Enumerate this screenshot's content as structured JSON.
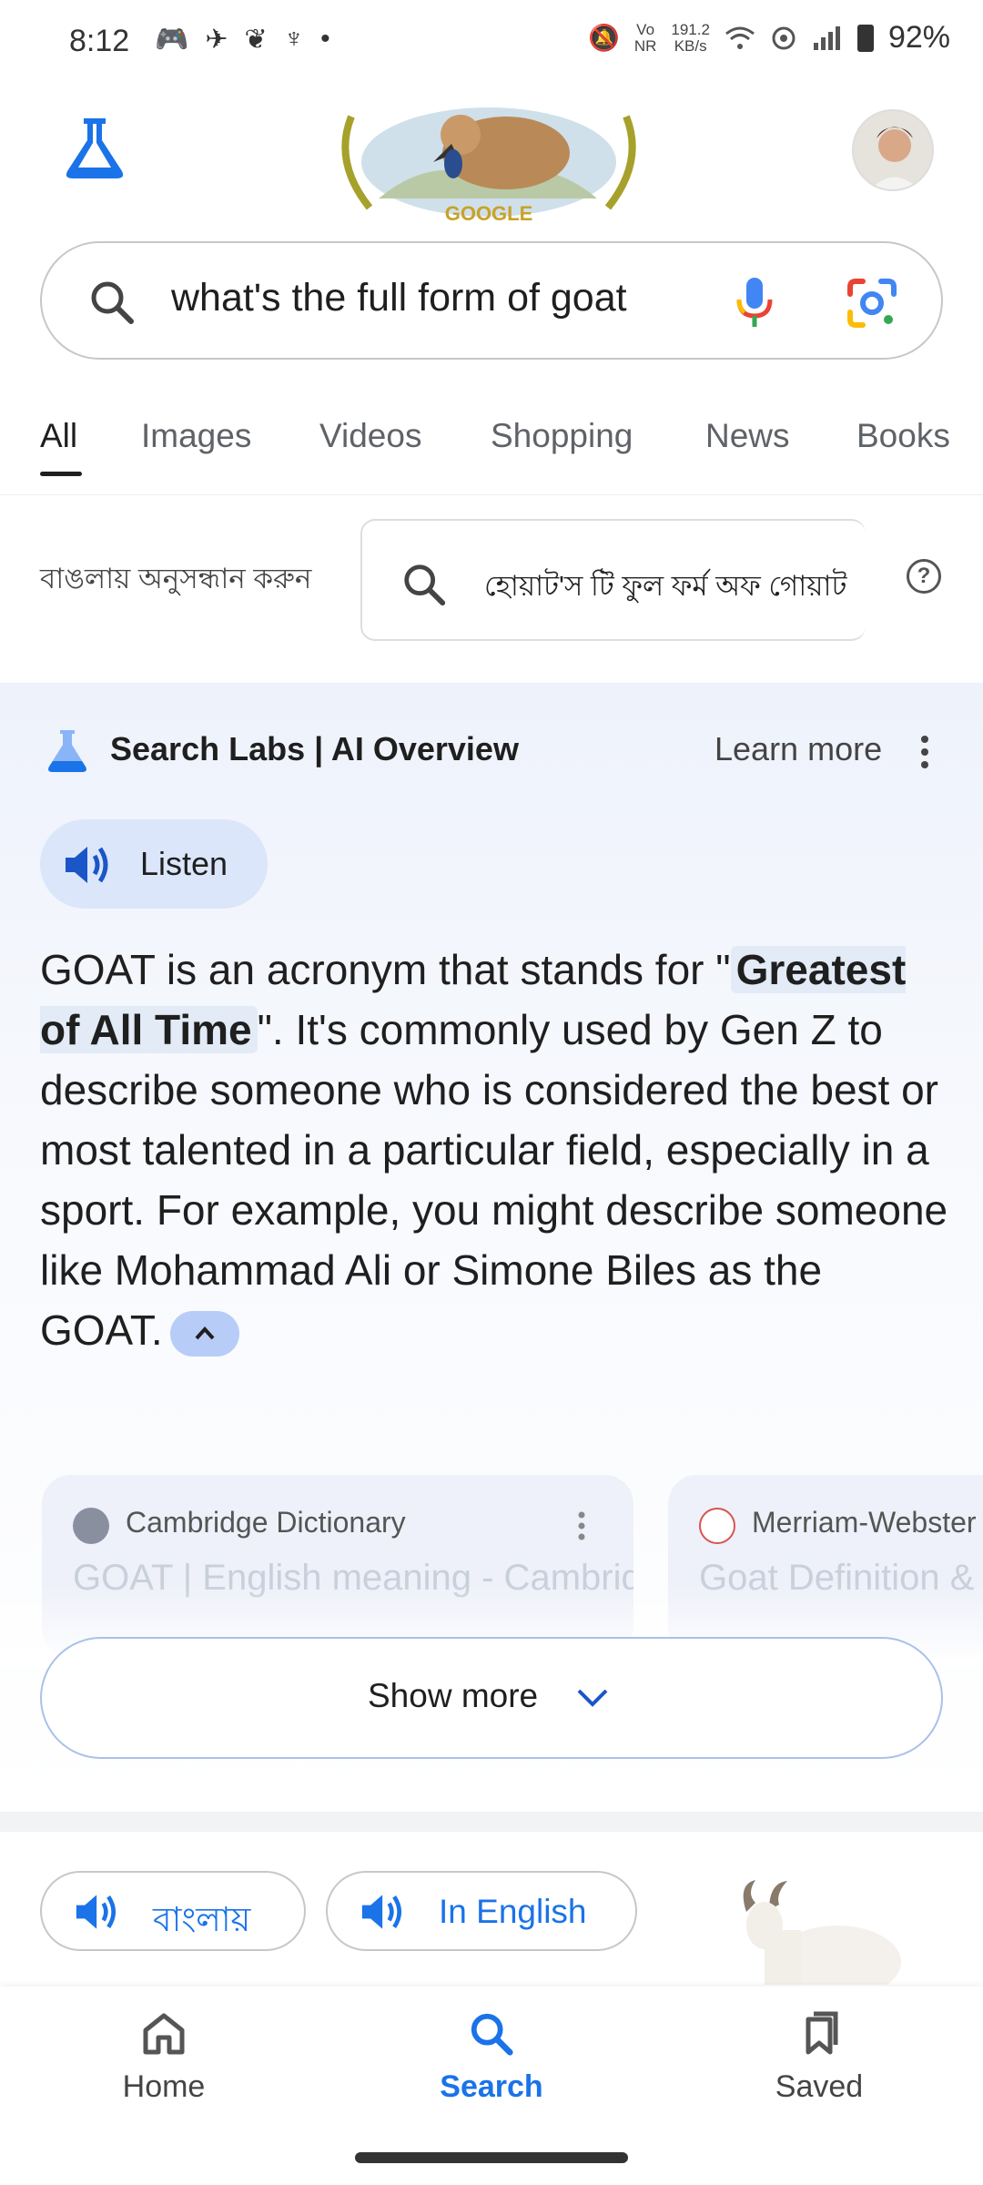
{
  "status_bar": {
    "time": "8:12",
    "net_speed_top": "191.2",
    "net_speed_unit": "KB/s",
    "vo_label": "Vo",
    "nr_label": "NR",
    "battery": "92%"
  },
  "header": {
    "doodle_text": "GOOGLE"
  },
  "search": {
    "query": "what's the full form of goat"
  },
  "tabs": [
    "All",
    "Images",
    "Videos",
    "Shopping",
    "News",
    "Books"
  ],
  "bengali": {
    "label": "বাঙলায় অনুসন্ধান করুন",
    "query": "হোয়াট'স টি ফুল ফর্ম অফ গোয়াট"
  },
  "ai_overview": {
    "title": "Search Labs | AI Overview",
    "learn_more": "Learn more",
    "listen_label": "Listen",
    "text_before": "GOAT is an acronym that stands for \"",
    "highlight": "Greatest of All Time",
    "text_after": "\". It's commonly used by Gen Z to describe someone who is considered the best or most talented in a particular field, especially in a sport. For example, you might describe someone like Mohammad Ali or Simone Biles as the GOAT.",
    "sources": [
      {
        "name": "Cambridge Dictionary",
        "title": "GOAT | English meaning - Cambridge Dictionary"
      },
      {
        "name": "Merriam-Webster",
        "title": "Goat Definition & Meaning - Merriam-Webster"
      }
    ],
    "show_more": "Show more"
  },
  "audio_pills": {
    "bengali": "বাংলায়",
    "english": "In English"
  },
  "bottom_nav": {
    "home": "Home",
    "search": "Search",
    "saved": "Saved"
  },
  "colors": {
    "accent": "#1a73e8",
    "ai_bg": "#eef2fb"
  }
}
